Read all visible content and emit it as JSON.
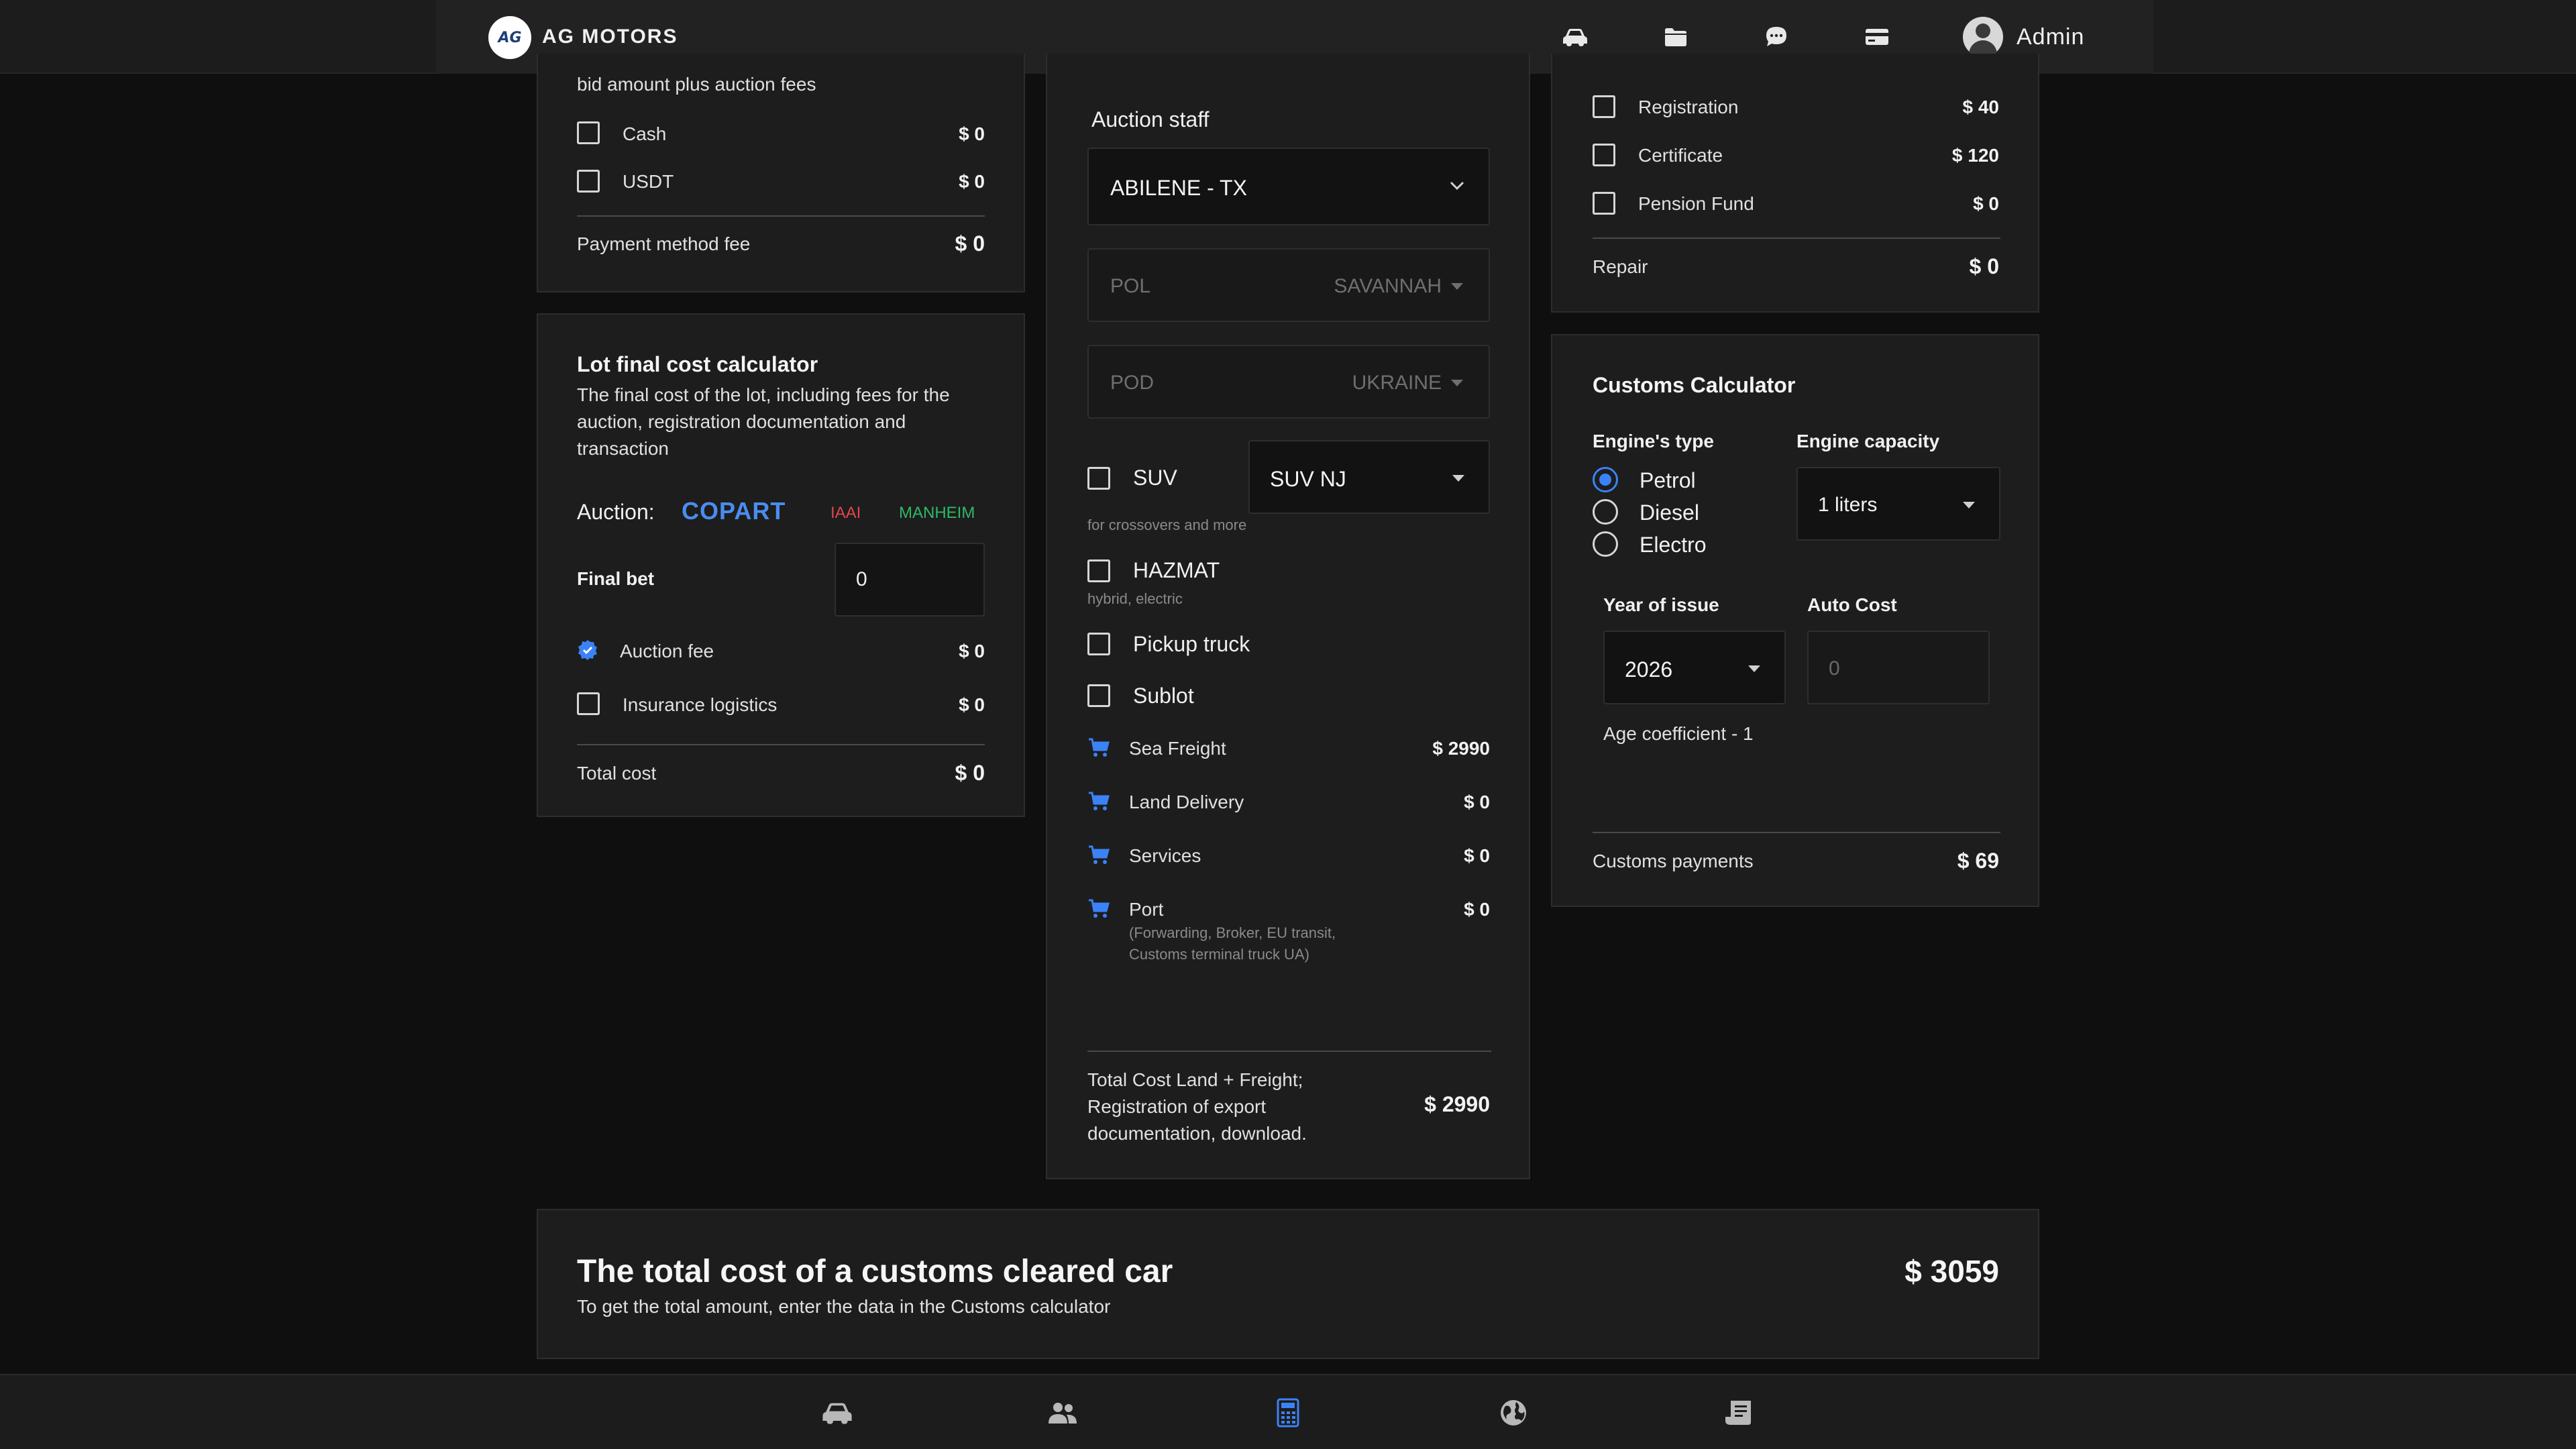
{
  "header": {
    "logo_text": "AG",
    "brand": "AG MOTORS",
    "icons": [
      "car-icon",
      "folder-icon",
      "chat-icon",
      "card-icon"
    ],
    "user": "Admin"
  },
  "payment": {
    "subtitle": "bid amount plus auction fees",
    "items": [
      {
        "label": "Cash",
        "value": "$ 0"
      },
      {
        "label": "USDT",
        "value": "$ 0"
      }
    ],
    "total_label": "Payment method fee",
    "total_value": "$ 0"
  },
  "lot": {
    "title": "Lot final cost calculator",
    "desc1": "The final cost of the lot, including fees for the",
    "desc2": "auction, registration documentation and",
    "desc3": "transaction",
    "auction_label": "Auction:",
    "auctions": [
      "COPART",
      "IAAI",
      "MANHEIM"
    ],
    "final_bet_label": "Final bet",
    "final_bet_value": "0",
    "items": [
      {
        "label": "Auction fee",
        "value": "$ 0",
        "checked": true
      },
      {
        "label": "Insurance logistics",
        "value": "$ 0",
        "checked": false
      }
    ],
    "total_label": "Total cost",
    "total_value": "$ 0"
  },
  "logistics": {
    "staff_label": "Auction staff",
    "staff_value": "ABILENE - TX",
    "pol_label": "POL",
    "pol_value": "SAVANNAH",
    "pod_label": "POD",
    "pod_value": "UKRAINE",
    "suv_label": "SUV",
    "suv_select": "SUV NJ",
    "suv_note": "for crossovers and more",
    "hazmat_label": "HAZMAT",
    "hazmat_note": "hybrid, electric",
    "pickup_label": "Pickup truck",
    "sublot_label": "Sublot",
    "costs": [
      {
        "label": "Sea Freight",
        "value": "$ 2990"
      },
      {
        "label": "Land Delivery",
        "value": "$ 0"
      },
      {
        "label": "Services",
        "value": "$ 0"
      },
      {
        "label": "Port",
        "value": "$ 0"
      }
    ],
    "port_note1": "(Forwarding, Broker, EU transit,",
    "port_note2": "Customs terminal truck UA)",
    "total_line1": "Total Cost Land + Freight;",
    "total_line2": "Registration of export",
    "total_line3": "documentation, download.",
    "total_value": "$ 2990"
  },
  "fees": {
    "items": [
      {
        "label": "Registration",
        "value": "$ 40"
      },
      {
        "label": "Certificate",
        "value": "$ 120"
      },
      {
        "label": "Pension Fund",
        "value": "$ 0"
      }
    ],
    "total_label": "Repair",
    "total_value": "$ 0"
  },
  "customs": {
    "title": "Customs Calculator",
    "engine_type_label": "Engine's type",
    "engine_types": [
      "Petrol",
      "Diesel",
      "Electro"
    ],
    "selected_engine": "Petrol",
    "capacity_label": "Engine capacity",
    "capacity_value": "1 liters",
    "year_label": "Year of issue",
    "year_value": "2026",
    "autocost_label": "Auto Cost",
    "autocost_placeholder": "0",
    "age_coef": "Age coefficient - 1",
    "payments_label": "Customs payments",
    "payments_value": "$ 69"
  },
  "summary": {
    "title": "The total cost of a customs cleared car",
    "subtitle": "To get the total amount, enter the data in the Customs calculator",
    "value": "$ 3059"
  },
  "bottom_nav": {
    "icons": [
      "car-icon",
      "users-icon",
      "calculator-icon",
      "globe-icon",
      "receipt-icon"
    ],
    "active": "calculator-icon",
    "active_color": "#3b82f6"
  },
  "colors": {
    "copart": "#4a8df0",
    "iaai": "#e0474c",
    "manheim": "#2fb866",
    "accent": "#3b82f6"
  }
}
